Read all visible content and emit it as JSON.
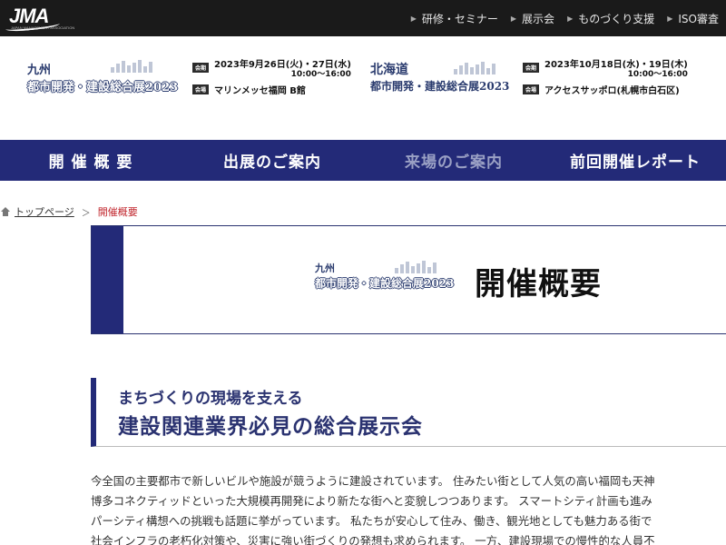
{
  "header": {
    "logo_text": "JMA",
    "logo_sub": "JAPAN MANAGEMENT ASSOCIATION",
    "nav": [
      {
        "label": "研修・セミナー"
      },
      {
        "label": "展示会"
      },
      {
        "label": "ものづくり支援"
      },
      {
        "label": "ISO審査"
      }
    ]
  },
  "events": [
    {
      "region": "九州",
      "name": "都市開発・建設総合展2023",
      "date_tag": "会期",
      "date": "2023年9月26日(火)・27日(水)",
      "time": "10:00〜16:00",
      "venue_tag": "会場",
      "venue": "マリンメッセ福岡 B館"
    },
    {
      "region": "北海道",
      "name": "都市開発・建設総合展2023",
      "date_tag": "会期",
      "date": "2023年10月18日(水)・19日(木)",
      "time": "10:00〜16:00",
      "venue_tag": "会場",
      "venue": "アクセスサッポロ(札幌市白石区)"
    }
  ],
  "main_nav": [
    {
      "label": "開 催 概 要"
    },
    {
      "label": "出展のご案内"
    },
    {
      "label": "来場のご案内"
    },
    {
      "label": "前回開催レポート"
    }
  ],
  "breadcrumb": {
    "home": "トップページ",
    "separator": "＞",
    "current": "開催概要"
  },
  "title_block": {
    "region": "九州",
    "name": "都市開発・建設総合展2023",
    "title": "開催概要"
  },
  "lead": {
    "sub": "まちづくりの現場を支える",
    "main": "建設関連業界必見の総合展示会"
  },
  "body_lines": [
    "今全国の主要都市で新しいビルや施設が競うように建設されています。 住みたい街として人気の高い福岡も天神",
    "博多コネクティッドといった大規模再開発により新たな街へと変貌しつつあります。 スマートシティ計画も進み",
    "パーシティ構想への挑戦も話題に挙がっています。 私たちが安心して住み、働き、観光地としても魅力ある街で",
    "社会インフラの老朽化対策や、災害に強い街づくりの発想も求められます。 一方、建設現場での慢性的な人員不"
  ],
  "colors": {
    "navy": "#232a78",
    "topbar": "#1a1a1a",
    "breadcrumb_current": "#c0262d"
  }
}
